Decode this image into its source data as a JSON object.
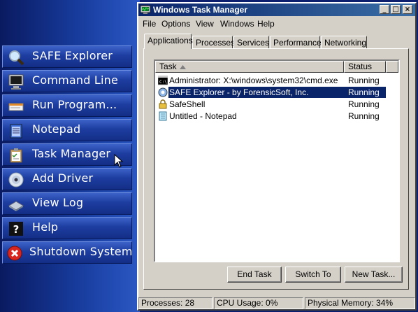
{
  "launcher": {
    "items": [
      {
        "label": "SAFE Explorer",
        "icon": "magnifier-icon"
      },
      {
        "label": "Command Line",
        "icon": "monitor-icon"
      },
      {
        "label": "Run Program...",
        "icon": "run-program-icon"
      },
      {
        "label": "Notepad",
        "icon": "notepad-icon"
      },
      {
        "label": "Task Manager",
        "icon": "clipboard-icon"
      },
      {
        "label": "Add Driver",
        "icon": "disc-icon"
      },
      {
        "label": "View Log",
        "icon": "log-icon"
      },
      {
        "label": "Help",
        "icon": "help-icon"
      },
      {
        "label": "Shutdown System",
        "icon": "shutdown-icon"
      }
    ]
  },
  "window": {
    "title": "Windows Task Manager",
    "caption_buttons": {
      "minimize": "_",
      "maximize": "□",
      "close": "×"
    }
  },
  "menu": [
    "File",
    "Options",
    "View",
    "Windows",
    "Help"
  ],
  "tabs": [
    "Applications",
    "Processes",
    "Services",
    "Performance",
    "Networking"
  ],
  "active_tab": "Applications",
  "list": {
    "columns": {
      "task": "Task",
      "status": "Status"
    },
    "rows": [
      {
        "task": "Administrator: X:\\windows\\system32\\cmd.exe",
        "status": "Running",
        "icon": "cmd-icon",
        "selected": false
      },
      {
        "task": "SAFE Explorer - by ForensicSoft, Inc.",
        "status": "Running",
        "icon": "safe-explorer-icon",
        "selected": true
      },
      {
        "task": "SafeShell",
        "status": "Running",
        "icon": "lock-icon",
        "selected": false
      },
      {
        "task": "Untitled - Notepad",
        "status": "Running",
        "icon": "notepad-icon",
        "selected": false
      }
    ]
  },
  "buttons": {
    "end_task": "End Task",
    "switch_to": "Switch To",
    "new_task": "New Task..."
  },
  "statusbar": {
    "processes": "Processes: 28",
    "cpu": "CPU Usage: 0%",
    "memory": "Physical Memory: 34%"
  },
  "colors": {
    "title_start": "#0a246a",
    "title_end": "#3a6ea5",
    "selection": "#0a246a",
    "launcher_bg": "#173b9c"
  }
}
